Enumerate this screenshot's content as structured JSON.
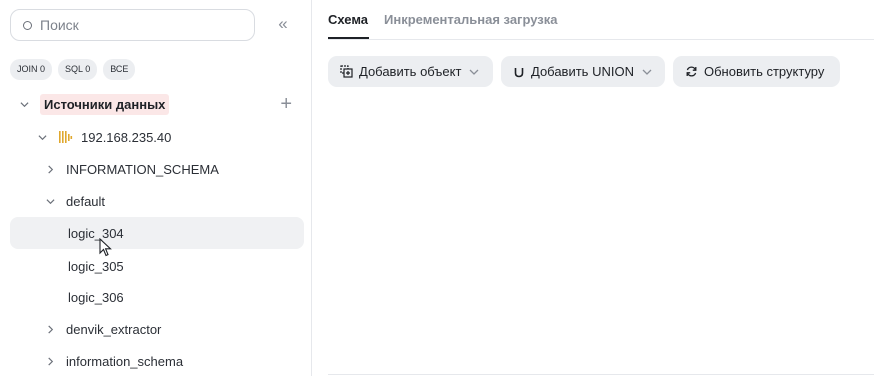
{
  "sidebar": {
    "search_placeholder": "Поиск",
    "chips": [
      "JOIN 0",
      "SQL 0",
      "ВСЕ"
    ],
    "tree": {
      "root_label": "Источники данных",
      "server_label": "192.168.235.40",
      "schemas": [
        {
          "label": "INFORMATION_SCHEMA"
        },
        {
          "label": "default"
        },
        {
          "label": "denvik_extractor"
        },
        {
          "label": "information_schema"
        }
      ],
      "tables": [
        "logic_304",
        "logic_305",
        "logic_306"
      ]
    }
  },
  "main": {
    "tabs": [
      "Схема",
      "Инкрементальная загрузка"
    ],
    "buttons": {
      "add_object": "Добавить объект",
      "add_union": "Добавить UNION",
      "refresh": "Обновить структуру"
    }
  },
  "colors": {
    "accent_root_bg": "#fbe7e7",
    "server_icon": "#e0a82e"
  }
}
